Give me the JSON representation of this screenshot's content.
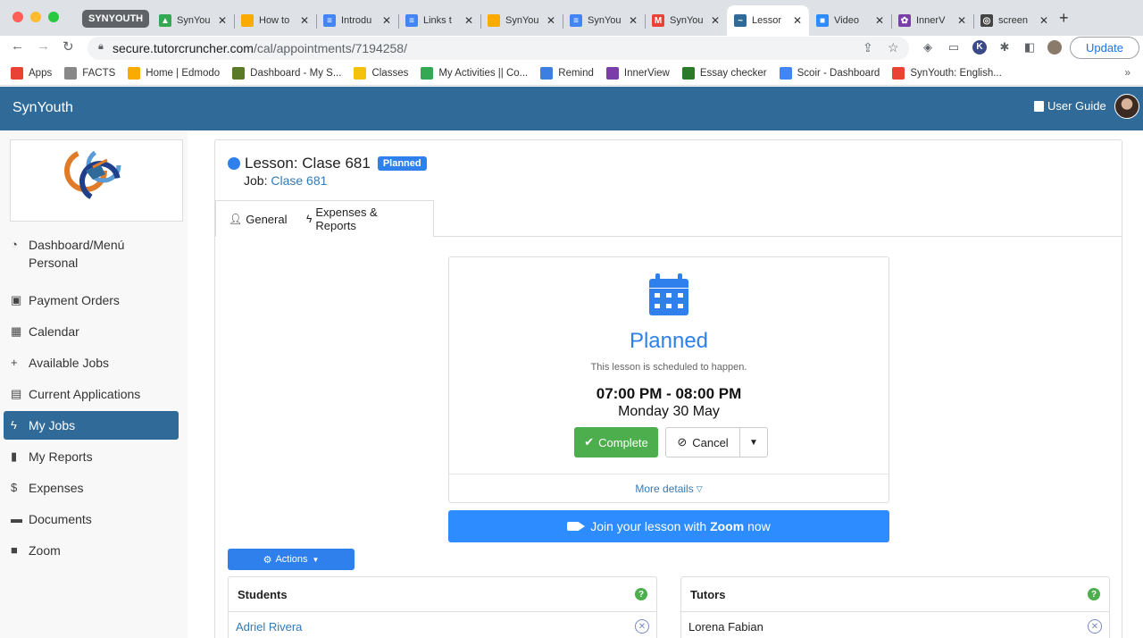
{
  "browser": {
    "tab_group": "SYNYOUTH",
    "tabs": [
      {
        "title": "SynYou",
        "color": "#34a853",
        "glyph": "▲"
      },
      {
        "title": "How to",
        "color": "#f9ab00",
        "glyph": ""
      },
      {
        "title": "Introdu",
        "color": "#4285f4",
        "glyph": "≡"
      },
      {
        "title": "Links t",
        "color": "#4285f4",
        "glyph": "≡"
      },
      {
        "title": "SynYou",
        "color": "#f9ab00",
        "glyph": ""
      },
      {
        "title": "SynYou",
        "color": "#4285f4",
        "glyph": "≡"
      },
      {
        "title": "SynYou",
        "color": "#ea4335",
        "glyph": "M"
      },
      {
        "title": "Lessor",
        "color": "#2f6a98",
        "glyph": "~"
      },
      {
        "title": "Video",
        "color": "#2d8cff",
        "glyph": "■"
      },
      {
        "title": "InnerV",
        "color": "#7a3ea8",
        "glyph": "✿"
      },
      {
        "title": "screen",
        "color": "#444444",
        "glyph": "◎"
      }
    ],
    "url_host": "secure.tutorcruncher.com",
    "url_path": "/cal/appointments/7194258/",
    "update_label": "Update",
    "bookmarks": [
      {
        "label": "Apps",
        "color": "#ea4335"
      },
      {
        "label": "FACTS",
        "color": "#888888"
      },
      {
        "label": "Home | Edmodo",
        "color": "#f9ab00"
      },
      {
        "label": "Dashboard - My S...",
        "color": "#5a7a2a"
      },
      {
        "label": "Classes",
        "color": "#f4c20d"
      },
      {
        "label": "My Activities || Co...",
        "color": "#34a853"
      },
      {
        "label": "Remind",
        "color": "#3d7fe0"
      },
      {
        "label": "InnerView",
        "color": "#7a3ea8"
      },
      {
        "label": "Essay checker",
        "color": "#2a7a2a"
      },
      {
        "label": "Scoir - Dashboard",
        "color": "#4285f4"
      },
      {
        "label": "SynYouth: English...",
        "color": "#ea4335"
      }
    ]
  },
  "app": {
    "brand": "SynYouth",
    "user_guide": "User Guide"
  },
  "sidebar": {
    "items": [
      {
        "label": "Dashboard/Menú Personal",
        "icon": "◔"
      },
      {
        "label": "Payment Orders",
        "icon": "▣"
      },
      {
        "label": "Calendar",
        "icon": "▦"
      },
      {
        "label": "Available Jobs",
        "icon": "+"
      },
      {
        "label": "Current Applications",
        "icon": "▤"
      },
      {
        "label": "My Jobs",
        "icon": "ϟ"
      },
      {
        "label": "My Reports",
        "icon": "▮"
      },
      {
        "label": "Expenses",
        "icon": "$"
      },
      {
        "label": "Documents",
        "icon": "▬"
      },
      {
        "label": "Zoom",
        "icon": "■"
      }
    ]
  },
  "lesson": {
    "title": "Lesson: Clase 681",
    "badge": "Planned",
    "job_prefix": "Job:",
    "job_link": "Clase 681",
    "tabs": [
      {
        "label": "General"
      },
      {
        "label": "Expenses & Reports"
      }
    ],
    "status": {
      "title": "Planned",
      "subtitle": "This lesson is scheduled to happen.",
      "time": "07:00 PM - 08:00 PM",
      "date": "Monday 30 May",
      "complete_label": "Complete",
      "cancel_label": "Cancel",
      "more_details": "More details"
    },
    "zoom": {
      "prefix": "Join your lesson with",
      "brand": "Zoom",
      "suffix": "now"
    },
    "actions_label": "Actions",
    "students": {
      "title": "Students",
      "items": [
        "Adriel Rivera"
      ]
    },
    "tutors": {
      "title": "Tutors",
      "items": [
        "Lorena Fabian"
      ]
    }
  }
}
